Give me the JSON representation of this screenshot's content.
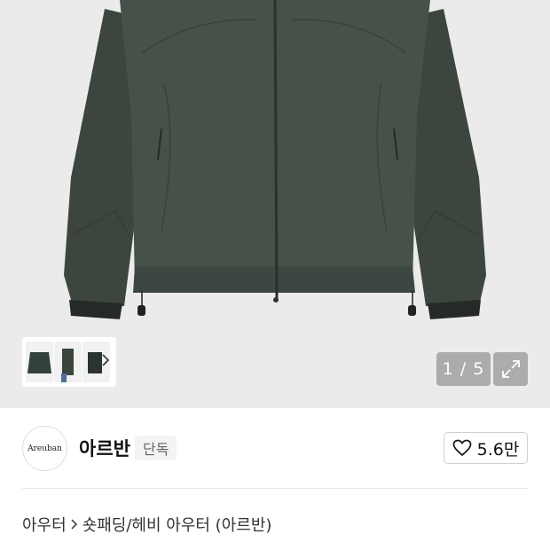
{
  "gallery": {
    "counter": "1 / 5",
    "thumbnail_arrow_icon": "chevron-right-icon",
    "expand_icon": "expand-icon",
    "background_color": "#ebebeb",
    "jacket_color": "#3f4a42"
  },
  "brand": {
    "logo_text": "Areuban",
    "name": "아르반",
    "badge": "단독",
    "like_icon": "heart-icon",
    "like_count": "5.6만"
  },
  "breadcrumb": {
    "items": [
      "아우터",
      "숏패딩/헤비 아우터 (아르반)"
    ],
    "separator_icon": "chevron-right-icon"
  }
}
